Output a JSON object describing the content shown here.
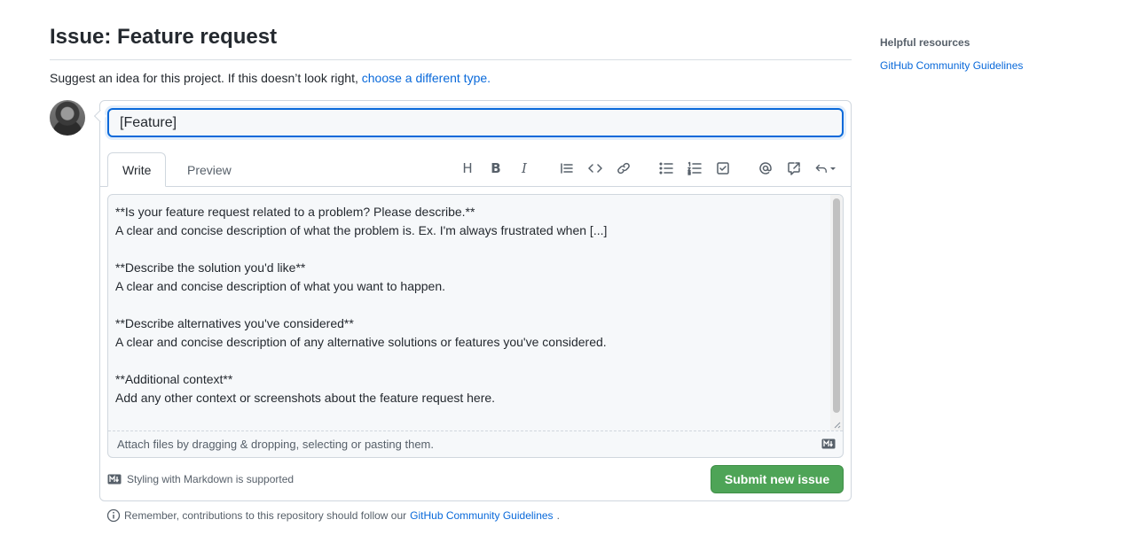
{
  "header": {
    "title": "Issue: Feature request",
    "intro_text": "Suggest an idea for this project. If this doesn’t look right, ",
    "intro_link": "choose a different type."
  },
  "form": {
    "title_value": "[Feature]",
    "tabs": [
      {
        "label": "Write",
        "active": true
      },
      {
        "label": "Preview",
        "active": false
      }
    ],
    "toolbar": {
      "heading_glyph": "H",
      "bold_glyph": "B",
      "italic_glyph": "I"
    },
    "body_text": "**Is your feature request related to a problem? Please describe.**\nA clear and concise description of what the problem is. Ex. I'm always frustrated when [...]\n\n**Describe the solution you'd like**\nA clear and concise description of what you want to happen.\n\n**Describe alternatives you've considered**\nA clear and concise description of any alternative solutions or features you've considered.\n\n**Additional context**\nAdd any other context or screenshots about the feature request here.",
    "attach_hint": "Attach files by dragging & dropping, selecting or pasting them.",
    "markdown_note": "Styling with Markdown is supported",
    "submit_label": "Submit new issue"
  },
  "footer": {
    "remember_text": "Remember, contributions to this repository should follow our ",
    "remember_link": "GitHub Community Guidelines",
    "remember_end": "."
  },
  "sidebar": {
    "heading": "Helpful resources",
    "link": "GitHub Community Guidelines"
  },
  "colors": {
    "accent": "#0969da",
    "submit": "#4ea457",
    "border": "#d0d7de"
  }
}
